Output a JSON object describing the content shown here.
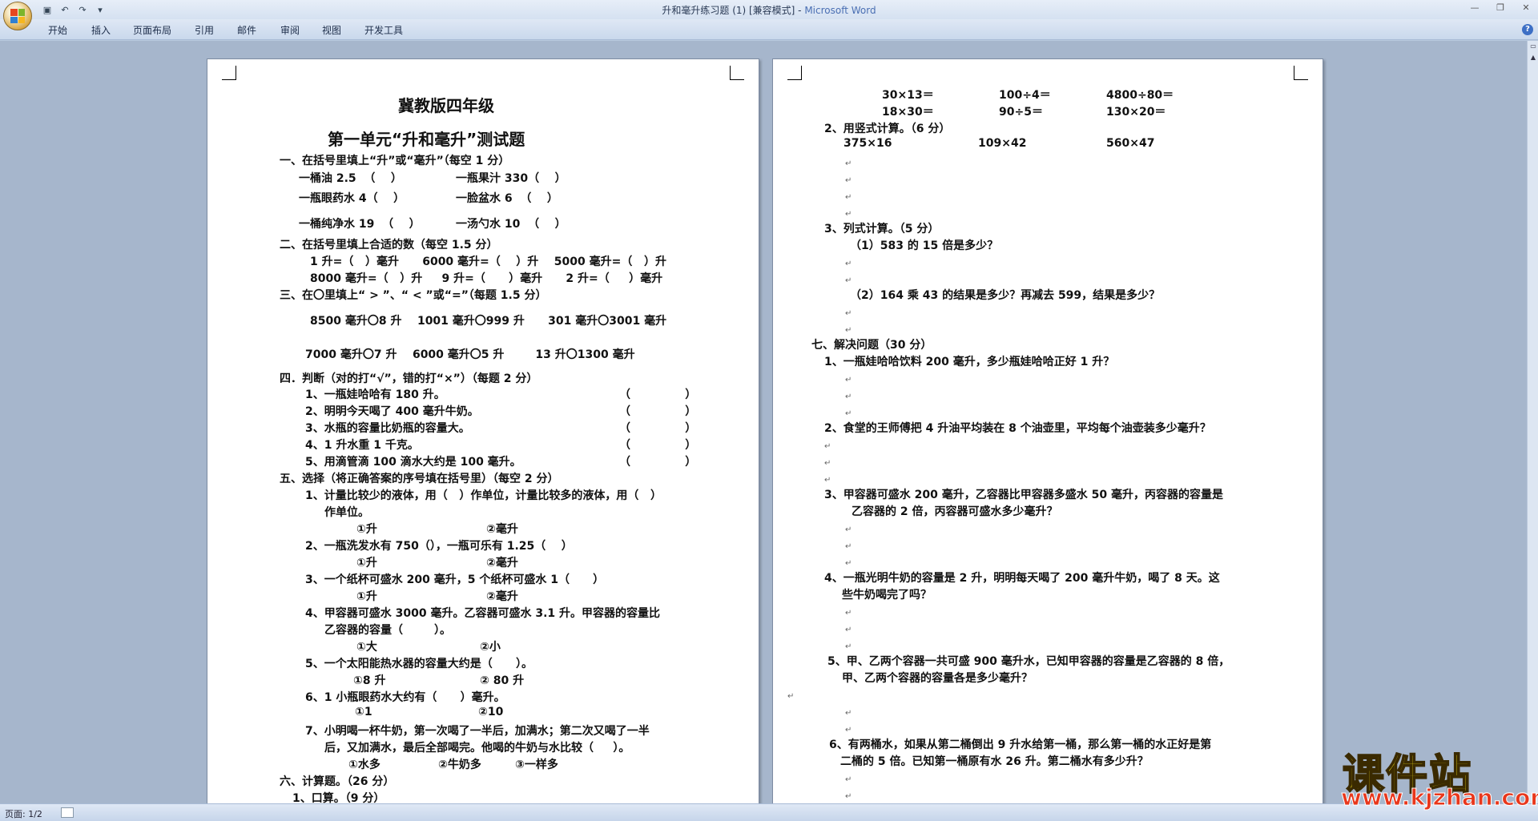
{
  "window": {
    "title": "升和毫升练习题 (1) [兼容模式] - ",
    "app": "Microsoft Word"
  },
  "ribbon": {
    "tabs": [
      "开始",
      "插入",
      "页面布局",
      "引用",
      "邮件",
      "审阅",
      "视图",
      "开发工具"
    ]
  },
  "status": {
    "page": "页面: 1/2"
  },
  "watermark": {
    "line1": "课件站",
    "line2": "www.kjzhan.com"
  },
  "page1": {
    "lines": [
      "冀教版四年级",
      "第一单元“升和毫升”测试题",
      "一、在括号里填上“升”或“毫升”（每空 1 分）",
      "一桶油 2.5  （    ）",
      "一瓶果汁 330（    ）",
      "一瓶眼药水 4（    ）",
      "一脸盆水 6  （    ）",
      "一桶纯净水 19  （    ）",
      "一汤勺水 10  （    ）",
      "二、在括号里填上合适的数（每空 1.5 分）",
      "1 升=（   ）毫升      6000 毫升=（    ）升    5000 毫升=（   ）升",
      "8000 毫升=（   ）升     9 升=（      ）毫升      2 升=（     ）毫升",
      "三、在〇里填上“ > ”、“ < ”或“=”（每题 1.5 分）",
      "8500 毫升〇8 升    1001 毫升〇999 升      301 毫升〇3001 毫升",
      "7000 毫升〇7 升    6000 毫升〇5 升        13 升〇1300 毫升",
      "四．判断（对的打“√”，错的打“×”）（每题 2 分）",
      "1、一瓶娃哈哈有 180 升。",
      "2、明明今天喝了 400 毫升牛奶。",
      "3、水瓶的容量比奶瓶的容量大。",
      "4、1 升水重 1 千克。",
      "5、用滴管滴 100 滴水大约是 100 毫升。",
      "（              ）",
      "五、选择（将正确答案的序号填在括号里）（每空 2 分）",
      "1、计量比较少的液体，用（   ）作单位，计量比较多的液体，用（   ）",
      "作单位。",
      "①升",
      "②毫升",
      "2、一瓶洗发水有 750（），一瓶可乐有 1.25（    ）",
      "3、一个纸杯可盛水 200 毫升，5 个纸杯可盛水 1（      ）",
      "4、甲容器可盛水 3000 毫升。乙容器可盛水 3.1 升。甲容器的容量比",
      "乙容器的容量（        ）。",
      "①大",
      "②小",
      "5、一个太阳能热水器的容量大约是（      ）。",
      "①8 升",
      "② 80 升",
      "6、1 小瓶眼药水大约有（      ）毫升。",
      "①1",
      "②10",
      "7、小明喝一杯牛奶，第一次喝了一半后，加满水；第二次又喝了一半",
      "后，又加满水，最后全部喝完。他喝的牛奶与水比较（     ）。",
      "①水多",
      "②牛奶多",
      "③一样多",
      "六、计算题。（26 分）",
      "1、口算。（9 分）"
    ]
  },
  "page2": {
    "lines": [
      "30×13＝",
      "100÷4＝",
      "4800÷80＝",
      "18×30＝",
      "90÷5＝",
      "130×20＝",
      "2、用竖式计算。（6 分）",
      "375×16",
      "109×42",
      "560×47",
      "3、列式计算。（5 分）",
      "（1）583 的 15 倍是多少？",
      "（2）164 乘 43 的结果是多少？再减去 599，结果是多少？",
      "七、解决问题（30 分）",
      "1、一瓶娃哈哈饮料 200 毫升，多少瓶娃哈哈正好 1 升？",
      "2、食堂的王师傅把 4 升油平均装在 8 个油壶里，平均每个油壶装多少毫升？",
      "3、甲容器可盛水 200 毫升，乙容器比甲容器多盛水 50 毫升，丙容器的容量是",
      "乙容器的 2 倍，丙容器可盛水多少毫升？",
      "4、一瓶光明牛奶的容量是 2 升，明明每天喝了 200 毫升牛奶，喝了 8 天。这",
      "些牛奶喝完了吗？",
      "5、甲、乙两个容器一共可盛 900 毫升水，已知甲容器的容量是乙容器的 8 倍，",
      "甲、乙两个容器的容量各是多少毫升？",
      "6、有两桶水，如果从第二桶倒出 9 升水给第一桶，那么第一桶的水正好是第",
      "二桶的 5 倍。已知第一桶原有水 26 升。第二桶水有多少升？"
    ]
  },
  "paragraph_mark": "↵"
}
